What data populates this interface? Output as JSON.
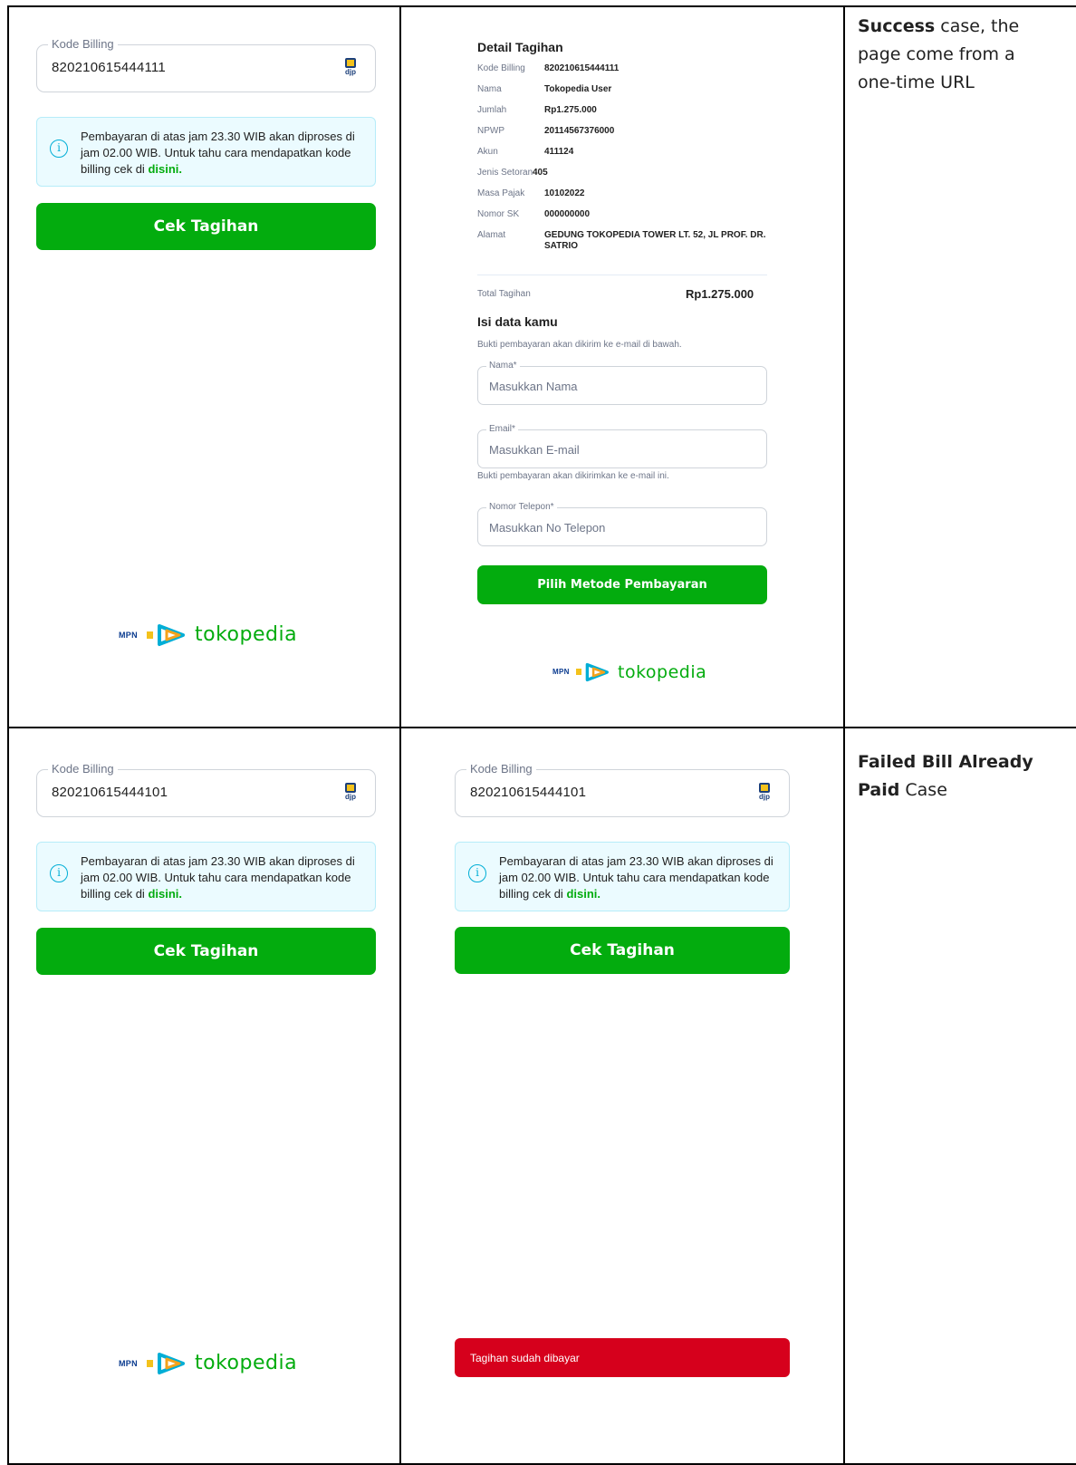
{
  "kode_billing_label": "Kode Billing",
  "djp_label": "djp",
  "info": {
    "text": "Pembayaran di atas jam 23.30 WIB akan diproses di jam 02.00 WIB. Untuk tahu cara mendapatkan kode billing cek di",
    "link": "disini."
  },
  "cek_button": "Cek Tagihan",
  "logo": {
    "mpn": "MPN",
    "brand": "tokopedia"
  },
  "panel_success_input": {
    "value": "820210615444111"
  },
  "detail": {
    "title": "Detail Tagihan",
    "rows": [
      {
        "label": "Kode Billing",
        "value": "820210615444111"
      },
      {
        "label": "Nama",
        "value": "Tokopedia User"
      },
      {
        "label": "Jumlah",
        "value": "Rp1.275.000"
      },
      {
        "label": "NPWP",
        "value": "20114567376000"
      },
      {
        "label": "Akun",
        "value": "411124"
      },
      {
        "label": "Jenis Setoran",
        "value": "405"
      },
      {
        "label": "Masa Pajak",
        "value": "10102022"
      },
      {
        "label": "Nomor SK",
        "value": "000000000"
      },
      {
        "label": "Alamat",
        "value": "GEDUNG TOKOPEDIA TOWER LT. 52, JL PROF. DR. SATRIO"
      }
    ],
    "total_label": "Total Tagihan",
    "total_value": "Rp1.275.000"
  },
  "form": {
    "title": "Isi data kamu",
    "subtitle": "Bukti pembayaran akan dikirim ke e-mail di bawah.",
    "nama_label": "Nama*",
    "nama_placeholder": "Masukkan Nama",
    "email_label": "Email*",
    "email_placeholder": "Masukkan E-mail",
    "email_help": "Bukti pembayaran akan dikirimkan ke e-mail ini.",
    "phone_label": "Nomor Telepon*",
    "phone_placeholder": "Masukkan No Telepon",
    "submit": "Pilih Metode Pembayaran"
  },
  "panel_failed_input": {
    "value": "820210615444101"
  },
  "toast": "Tagihan sudah dibayar",
  "notes": {
    "success_bold": "Success",
    "success_rest_1": " case, the",
    "success_line_2": "page come from a",
    "success_line_3": "one-time URL",
    "failed_bold_1": "Failed Bill Already",
    "failed_bold_2": "Paid",
    "failed_rest": " Case"
  },
  "colors": {
    "green": "#03AC0E",
    "red": "#D6001C",
    "info_bg": "#EBFBFF",
    "info_border": "#B6ECF9"
  }
}
